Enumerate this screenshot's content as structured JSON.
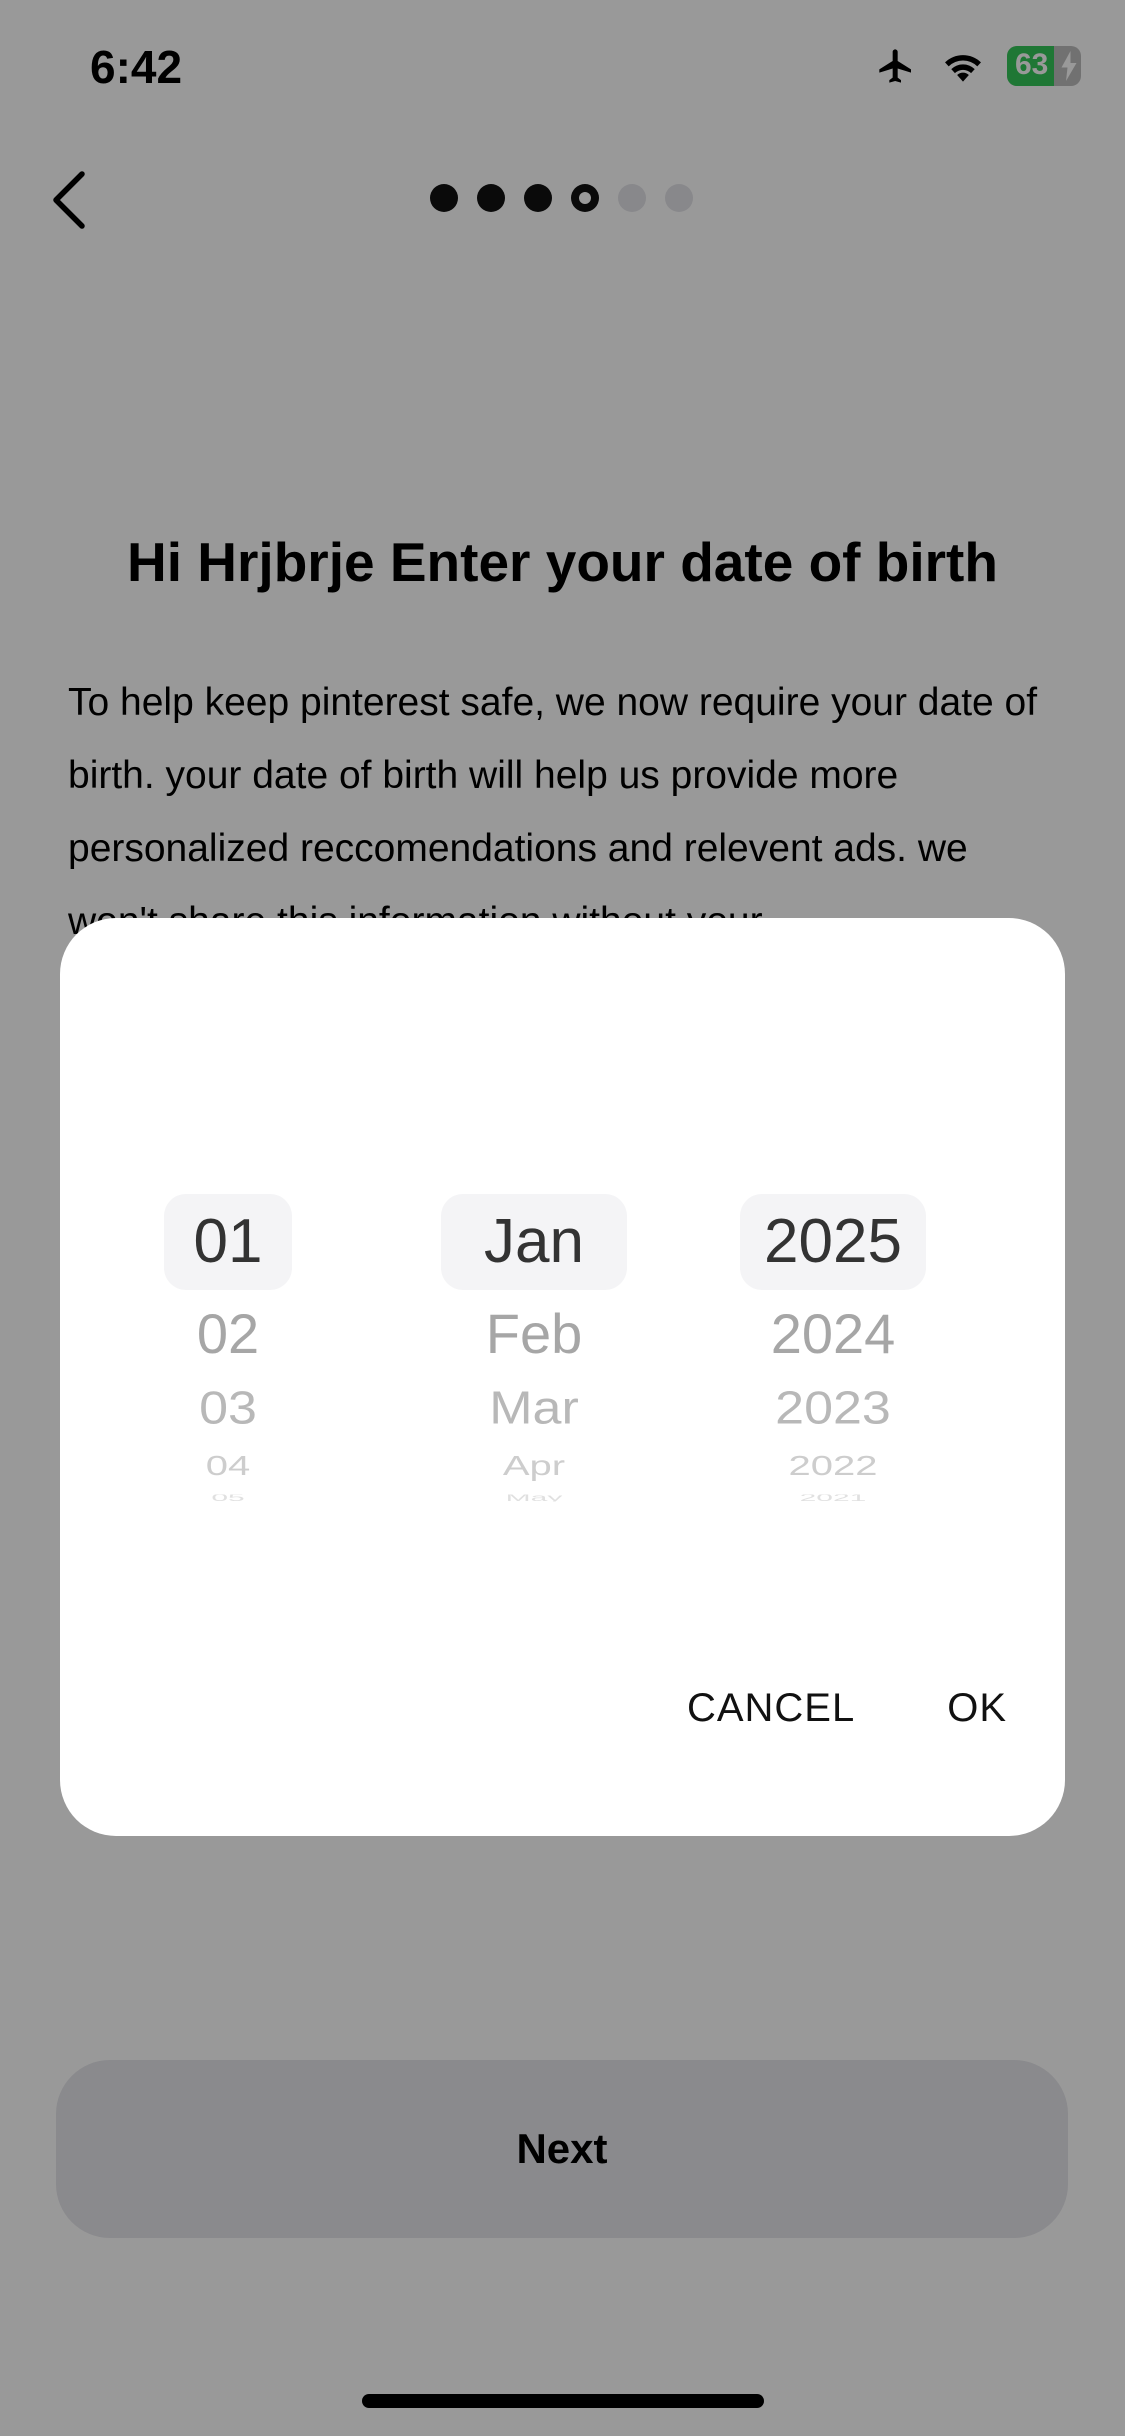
{
  "status_bar": {
    "time": "6:42",
    "battery_percent": "63",
    "battery_level": 0.63,
    "icons": [
      "airplane-icon",
      "wifi-icon",
      "battery-icon"
    ]
  },
  "nav": {
    "back_icon": "chevron-left-icon",
    "progress": {
      "total_steps": 6,
      "current_step": 4
    }
  },
  "page": {
    "title": "Hi Hrjbrje Enter your date of birth",
    "body": "To help keep pinterest safe, we now require your date of birth. your date of birth will help us provide more personalized reccomendations and relevent ads. we won't share this information without your"
  },
  "dialog": {
    "day": {
      "selected": "01",
      "following": [
        "02",
        "03",
        "04",
        "05"
      ]
    },
    "month": {
      "selected": "Jan",
      "following": [
        "Feb",
        "Mar",
        "Apr",
        "May"
      ]
    },
    "year": {
      "selected": "2025",
      "following": [
        "2024",
        "2023",
        "2022",
        "2021"
      ]
    },
    "cancel_label": "CANCEL",
    "ok_label": "OK"
  },
  "footer": {
    "next_label": "Next"
  },
  "colors": {
    "scrim": "rgba(0,0,0,0.40)",
    "battery_green": "#34c759",
    "button_bg": "#e6e6eb",
    "selected_row_bg": "#f4f4f6"
  }
}
